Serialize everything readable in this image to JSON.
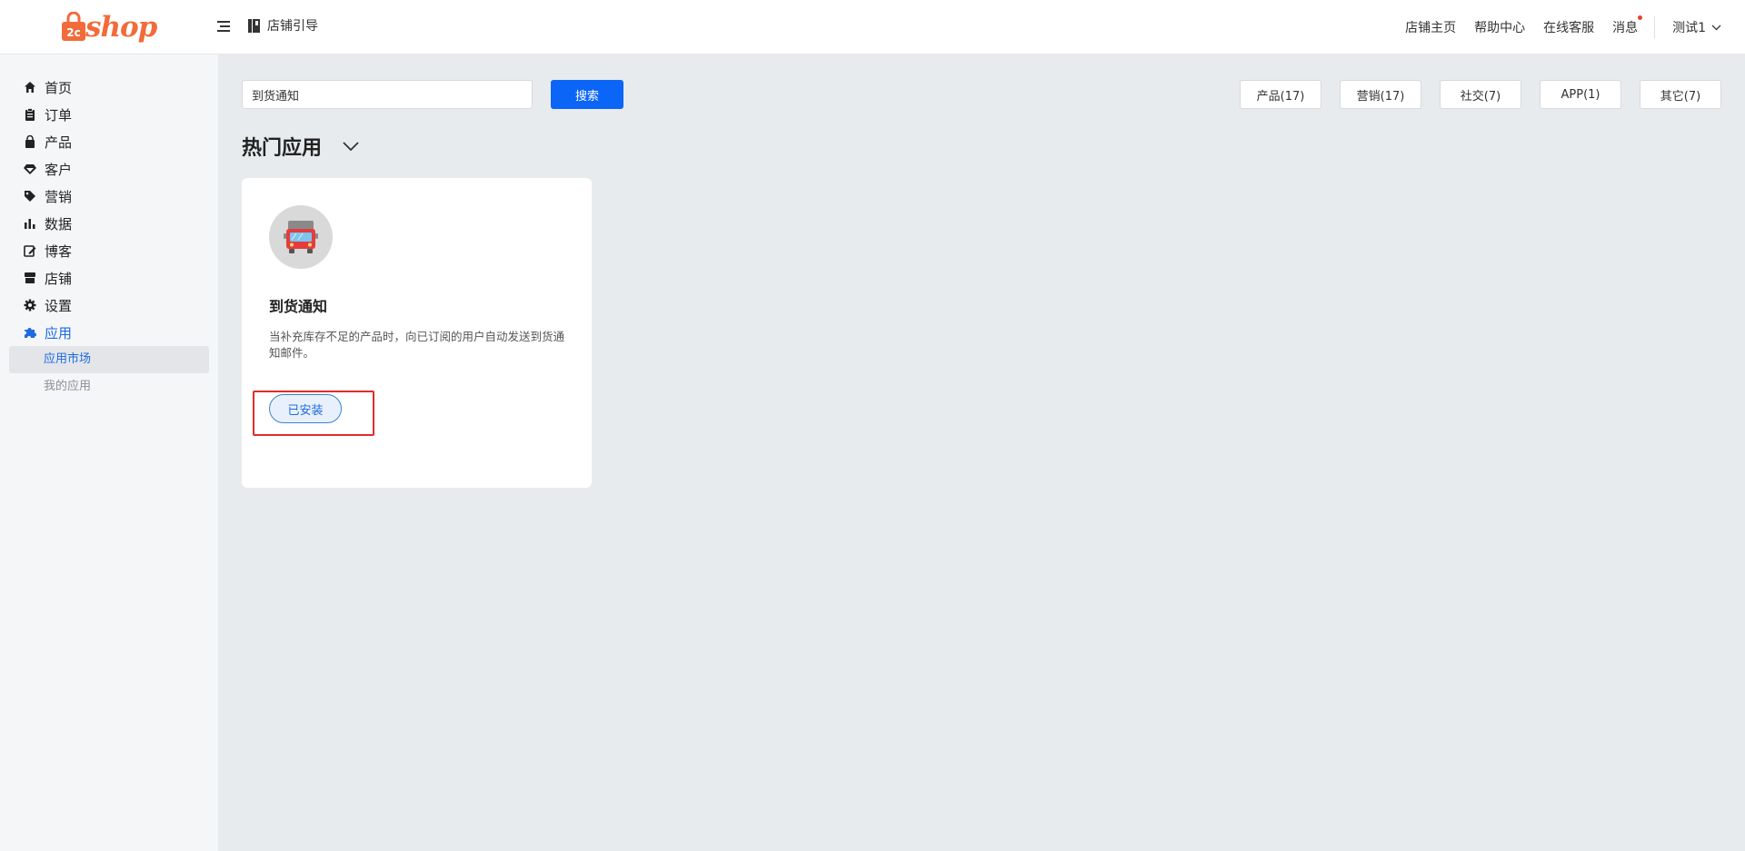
{
  "brand": {
    "logo_text": "shop",
    "accent": "#f26b3a"
  },
  "header": {
    "guide_label": "店铺引导",
    "links": [
      "店铺主页",
      "帮助中心",
      "在线客服",
      "消息"
    ],
    "user_label": "测试1"
  },
  "sidebar": {
    "items": [
      {
        "label": "首页",
        "icon": "home-icon"
      },
      {
        "label": "订单",
        "icon": "clipboard-icon"
      },
      {
        "label": "产品",
        "icon": "shopping-bag-icon"
      },
      {
        "label": "客户",
        "icon": "gem-icon"
      },
      {
        "label": "营销",
        "icon": "tag-icon"
      },
      {
        "label": "数据",
        "icon": "bar-chart-icon"
      },
      {
        "label": "博客",
        "icon": "edit-icon"
      },
      {
        "label": "店铺",
        "icon": "store-icon"
      },
      {
        "label": "设置",
        "icon": "gear-icon"
      },
      {
        "label": "应用",
        "icon": "puzzle-icon"
      }
    ],
    "sub_items": [
      {
        "label": "应用市场",
        "active": true
      },
      {
        "label": "我的应用",
        "active": false
      }
    ]
  },
  "search": {
    "value": "到货通知",
    "button_label": "搜索"
  },
  "filters": [
    "产品(17)",
    "营销(17)",
    "社交(7)",
    "APP(1)",
    "其它(7)"
  ],
  "section": {
    "title": "热门应用"
  },
  "app_card": {
    "name": "到货通知",
    "description": "当补充库存不足的产品时，向已订阅的用户自动发送到货通知邮件。",
    "status_label": "已安装",
    "icon": "delivery-truck-icon"
  },
  "colors": {
    "primary": "#0b65f6",
    "highlight": "#e22b2b",
    "active_nav": "#1e6ae1"
  }
}
